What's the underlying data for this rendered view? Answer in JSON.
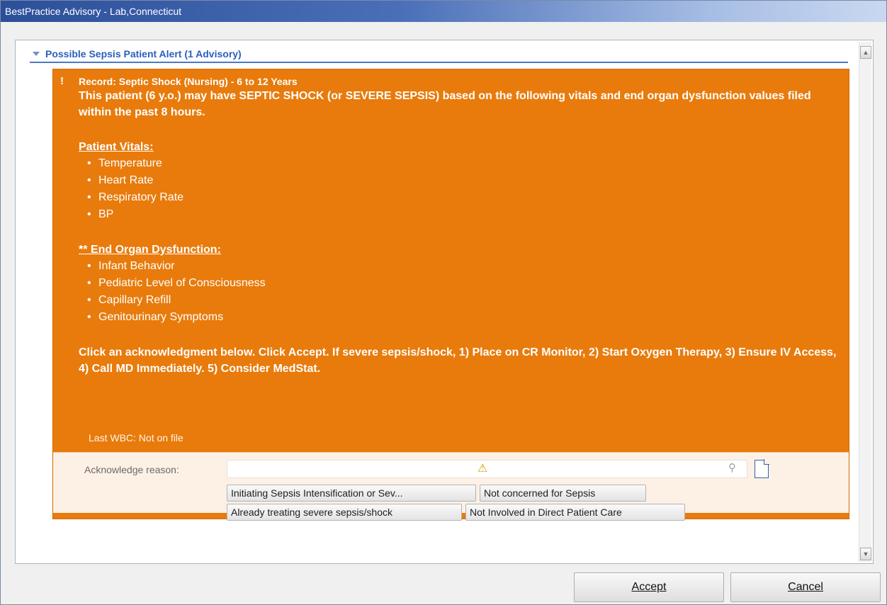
{
  "window": {
    "title": "BestPractice Advisory  - Lab,Connecticut"
  },
  "section": {
    "header": "Possible Sepsis Patient Alert (1 Advisory)"
  },
  "advisory": {
    "record_title": "Record: Septic Shock (Nursing) - 6 to 12 Years",
    "description": "This patient (6 y.o.) may have SEPTIC SHOCK (or SEVERE SEPSIS) based on the following vitals and end organ dysfunction values filed within the past 8 hours.",
    "vitals_heading": "Patient Vitals:",
    "vitals": [
      "Temperature",
      "Heart Rate",
      "Respiratory Rate",
      "BP"
    ],
    "organ_heading": "** End Organ Dysfunction:",
    "organ_items": [
      "Infant Behavior",
      "Pediatric Level of Consciousness",
      "Capillary Refill",
      "Genitourinary Symptoms"
    ],
    "instructions": "Click an acknowledgment below. Click Accept. If severe sepsis/shock, 1) Place on CR Monitor, 2) Start Oxygen Therapy, 3) Ensure IV Access, 4) Call MD Immediately. 5) Consider MedStat.",
    "last_wbc": "Last WBC: Not on file",
    "icons": {
      "warning": "exclamation-icon",
      "alert": "warning-triangle-icon",
      "search": "magnifier-icon",
      "document": "document-icon"
    }
  },
  "acknowledge": {
    "label": "Acknowledge reason:",
    "value": "",
    "reasons": [
      "Initiating Sepsis Intensification or Sev...",
      "Not concerned for Sepsis",
      "Already treating severe sepsis/shock",
      "Not Involved in Direct Patient Care"
    ]
  },
  "footer": {
    "accept": "Accept",
    "cancel": "Cancel"
  },
  "colors": {
    "title_bar": "#2c4f9a",
    "advisory_bg": "#e87b0c",
    "header_text": "#2a5fbe",
    "ack_panel_bg": "#fdf1e6"
  }
}
